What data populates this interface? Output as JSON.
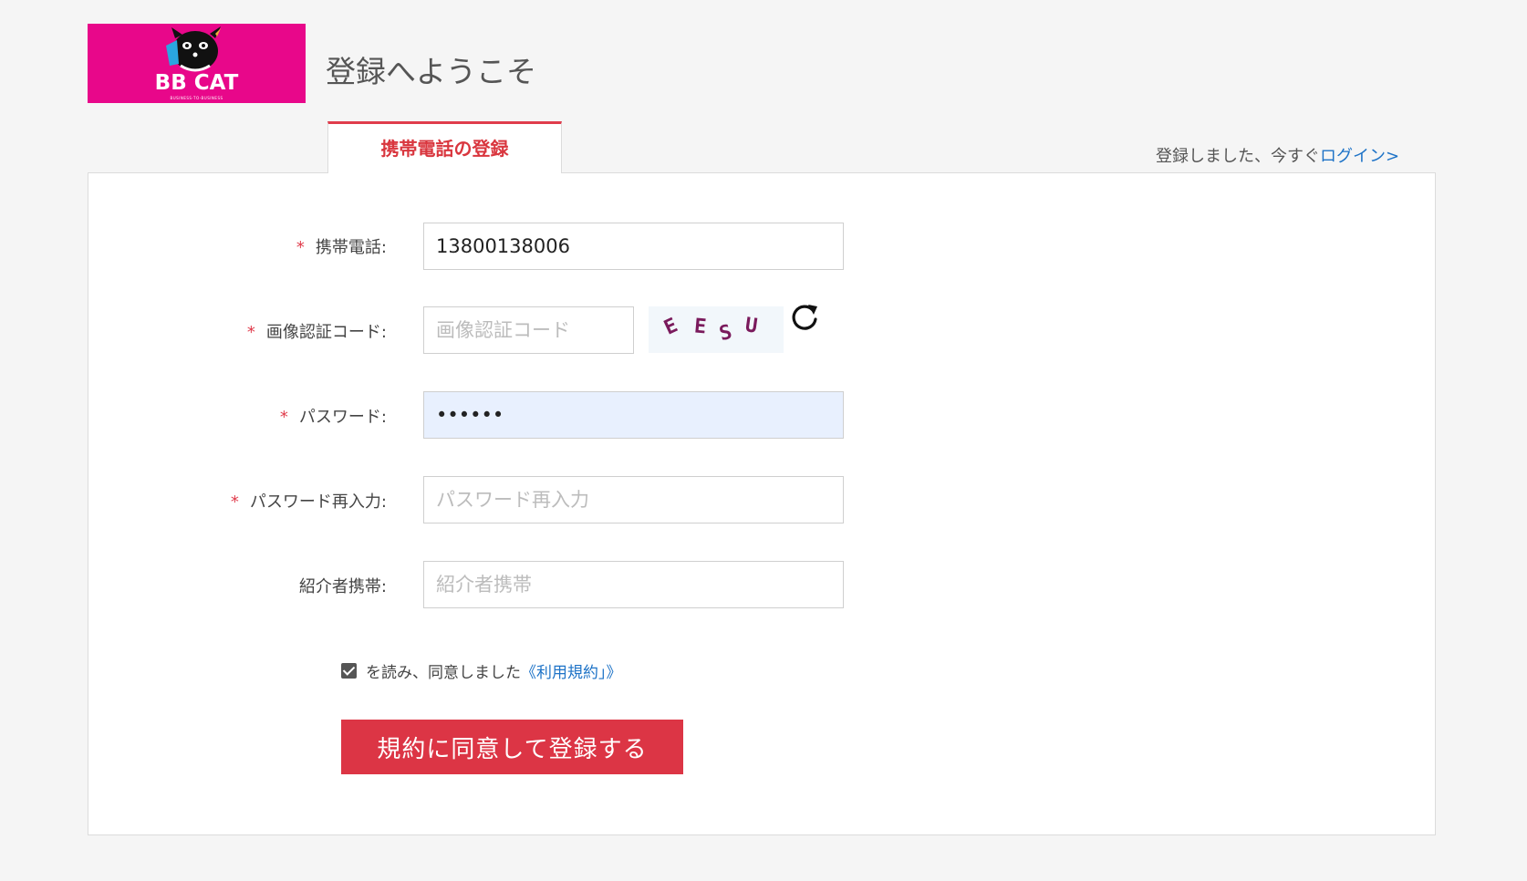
{
  "header": {
    "logo_text": "BB CAT",
    "logo_tagline": "BUSINESS-TO-BUSINESS",
    "welcome": "登録へようこそ"
  },
  "tab": {
    "label": "携帯電話の登録"
  },
  "login_hint": {
    "prefix": "登録しました、今すぐ",
    "link": "ログイン>"
  },
  "form": {
    "phone": {
      "label": "携帯電話:",
      "value": "13800138006",
      "required": "*"
    },
    "captcha": {
      "label": "画像認証コード:",
      "placeholder": "画像認証コード",
      "required": "*",
      "chars": [
        "E",
        "E",
        "S",
        "U"
      ]
    },
    "password": {
      "label": "パスワード:",
      "value": "••••••",
      "required": "*"
    },
    "password_confirm": {
      "label": "パスワード再入力:",
      "placeholder": "パスワード再入力",
      "required": "*"
    },
    "referrer": {
      "label": "紹介者携帯:",
      "placeholder": "紹介者携帯"
    },
    "agree": {
      "text": "を読み、同意しました",
      "link": "《利用規約」》"
    },
    "submit_label": "規約に同意して登録する"
  },
  "colors": {
    "brand": "#e8078a",
    "accent": "#dc3545",
    "link": "#1e73c7"
  }
}
